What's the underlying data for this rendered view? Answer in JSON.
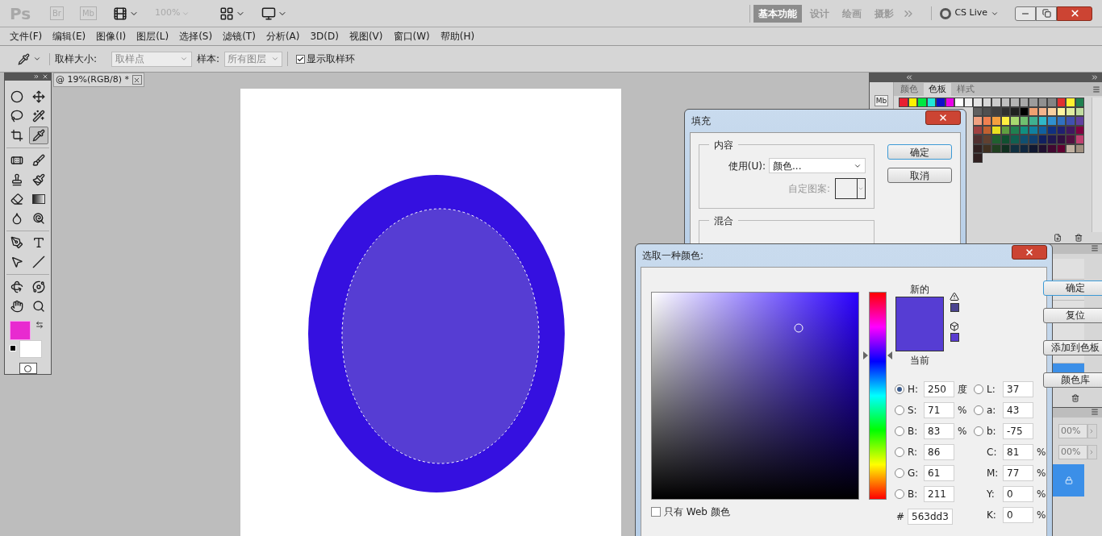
{
  "app_bar": {
    "logo": "Ps",
    "bridge": "Br",
    "mini_bridge": "Mb",
    "zoom": "100%",
    "workspaces": [
      {
        "label": "基本功能",
        "selected": true
      },
      {
        "label": "设计",
        "selected": false
      },
      {
        "label": "绘画",
        "selected": false
      },
      {
        "label": "摄影",
        "selected": false
      }
    ],
    "cs_live": "CS Live"
  },
  "menu": [
    "文件(F)",
    "编辑(E)",
    "图像(I)",
    "图层(L)",
    "选择(S)",
    "滤镜(T)",
    "分析(A)",
    "3D(D)",
    "视图(V)",
    "窗口(W)",
    "帮助(H)"
  ],
  "options_bar": {
    "sample_size_label": "取样大小:",
    "sample_size": "取样点",
    "sample_label": "样本:",
    "sample": "所有图层",
    "show_ring": {
      "label": "显示取样环",
      "checked": true
    }
  },
  "document_tab": {
    "title": "@ 19%(RGB/8) *"
  },
  "tools": [
    {
      "selected": false
    },
    {
      "selected": false
    },
    {
      "selected": false
    },
    {
      "selected": false
    },
    {
      "selected": false
    },
    {
      "selected": true
    },
    {
      "selected": false
    },
    {
      "selected": false
    },
    {
      "selected": false
    },
    {
      "selected": false
    },
    {
      "selected": false
    },
    {
      "selected": false
    },
    {
      "selected": false
    },
    {
      "selected": false
    },
    {
      "selected": false
    },
    {
      "selected": false
    },
    {
      "selected": false
    },
    {
      "selected": false
    },
    {
      "selected": false
    },
    {
      "selected": false
    },
    {
      "selected": false
    },
    {
      "selected": false
    }
  ],
  "panel_mini_bridge": "Mb",
  "swatches_panel": {
    "tabs": [
      {
        "label": "颜色",
        "selected": false
      },
      {
        "label": "色板",
        "selected": true
      },
      {
        "label": "样式",
        "selected": false
      }
    ],
    "rows": [
      [
        {
          "color": "#e82030"
        },
        {
          "color": "#fff200"
        },
        {
          "color": "#00e840"
        },
        {
          "color": "#20e8d8"
        },
        {
          "color": "#1010c8"
        },
        {
          "color": "#e800e8"
        },
        {
          "color": "#ffffff"
        },
        {
          "color": "#f2f2f2"
        },
        {
          "color": "#e4e4e4"
        },
        {
          "color": "#d8d8d8"
        },
        {
          "color": "#cccccc"
        },
        {
          "color": "#c0c0c0"
        },
        {
          "color": "#b4b4b4"
        },
        {
          "color": "#a8a8a8"
        },
        {
          "color": "#9c9c9c"
        },
        {
          "color": "#909090"
        },
        {
          "color": "#848484"
        },
        {
          "color": "#e03030"
        },
        {
          "color": "#fff030"
        },
        {
          "color": "#208050"
        }
      ],
      [
        {
          "color": "#606060"
        },
        {
          "color": "#505050"
        },
        {
          "color": "#404040"
        },
        {
          "color": "#303030"
        },
        {
          "color": "#202020"
        },
        {
          "color": "#000000"
        },
        {
          "color": "#f0a070"
        },
        {
          "color": "#f4b48c"
        },
        {
          "color": "#f8d0a0"
        },
        {
          "color": "#fff4a0"
        },
        {
          "color": "#e0eca0"
        },
        {
          "color": "#c0dca0"
        }
      ],
      [
        {
          "color": "#f0a080"
        },
        {
          "color": "#f08050"
        },
        {
          "color": "#f4a040"
        },
        {
          "color": "#fff040"
        },
        {
          "color": "#a8d870"
        },
        {
          "color": "#70c070"
        },
        {
          "color": "#40b090"
        },
        {
          "color": "#30b8c8"
        },
        {
          "color": "#3090d0"
        },
        {
          "color": "#3070c0"
        },
        {
          "color": "#4050b0"
        },
        {
          "color": "#6040a0"
        }
      ],
      [
        {
          "color": "#a04040"
        },
        {
          "color": "#c06030"
        },
        {
          "color": "#e8e020"
        },
        {
          "color": "#60a040"
        },
        {
          "color": "#208050"
        },
        {
          "color": "#109080"
        },
        {
          "color": "#1080a0"
        },
        {
          "color": "#1060a0"
        },
        {
          "color": "#103080"
        },
        {
          "color": "#202070"
        },
        {
          "color": "#401860"
        },
        {
          "color": "#800040"
        }
      ],
      [
        {
          "color": "#503030"
        },
        {
          "color": "#604030"
        },
        {
          "color": "#206030"
        },
        {
          "color": "#105030"
        },
        {
          "color": "#106050"
        },
        {
          "color": "#105070"
        },
        {
          "color": "#104070"
        },
        {
          "color": "#102060"
        },
        {
          "color": "#201850"
        },
        {
          "color": "#301040"
        },
        {
          "color": "#501040"
        },
        {
          "color": "#c04070"
        }
      ],
      [
        {
          "color": "#302020"
        },
        {
          "color": "#403020"
        },
        {
          "color": "#204020"
        },
        {
          "color": "#103020"
        },
        {
          "color": "#103040"
        },
        {
          "color": "#102840"
        },
        {
          "color": "#101830"
        },
        {
          "color": "#201030"
        },
        {
          "color": "#400830"
        },
        {
          "color": "#600030"
        },
        {
          "color": "#c0b0a0"
        },
        {
          "color": "#a09080"
        }
      ],
      [
        {
          "color": "#302020"
        }
      ]
    ]
  },
  "panel_2": {
    "rows": [
      {
        "selected": false
      },
      {
        "selected": false
      },
      {
        "selected": false
      },
      {
        "selected": false
      },
      {
        "selected": false
      },
      {
        "selected": true
      }
    ]
  },
  "layers_panel": {
    "opacity": "00%",
    "fill": "00%",
    "rows": [
      {
        "selected": true,
        "locked": true
      }
    ]
  },
  "fill_dialog": {
    "title": "填充",
    "contents_group": "内容",
    "use_label": "使用(U):",
    "use_value": "颜色...",
    "pattern_label": "自定图案:",
    "pattern_disabled": true,
    "blend_group": "混合",
    "ok": "确定",
    "cancel": "取消"
  },
  "color_picker": {
    "title": "选取一种颜色:",
    "new_label": "新的",
    "current_label": "当前",
    "buttons": [
      "确定",
      "复位",
      "添加到色板",
      "颜色库"
    ],
    "left_fields": [
      {
        "kind": "radio",
        "label": "H:",
        "value": "250",
        "unit": "度",
        "selected": true
      },
      {
        "kind": "radio",
        "label": "S:",
        "value": "71",
        "unit": "%",
        "selected": false
      },
      {
        "kind": "radio",
        "label": "B:",
        "value": "83",
        "unit": "%",
        "selected": false
      },
      {
        "kind": "radio",
        "label": "R:",
        "value": "86",
        "selected": false
      },
      {
        "kind": "radio",
        "label": "G:",
        "value": "61",
        "selected": false
      },
      {
        "kind": "radio",
        "label": "B:",
        "value": "211",
        "selected": false
      }
    ],
    "right_fields": [
      {
        "kind": "radio",
        "label": "L:",
        "value": "37",
        "selected": false
      },
      {
        "kind": "radio",
        "label": "a:",
        "value": "43",
        "selected": false
      },
      {
        "kind": "radio",
        "label": "b:",
        "value": "-75",
        "selected": false
      },
      {
        "kind": "plain",
        "label": "C:",
        "value": "81",
        "unit": "%"
      },
      {
        "kind": "plain",
        "label": "M:",
        "value": "77",
        "unit": "%"
      },
      {
        "kind": "plain",
        "label": "Y:",
        "value": "0",
        "unit": "%"
      },
      {
        "kind": "plain",
        "label": "K:",
        "value": "0",
        "unit": "%"
      }
    ],
    "hex_label": "#",
    "hex": "563dd3",
    "web_only": {
      "label": "只有 Web 颜色",
      "checked": false
    }
  }
}
